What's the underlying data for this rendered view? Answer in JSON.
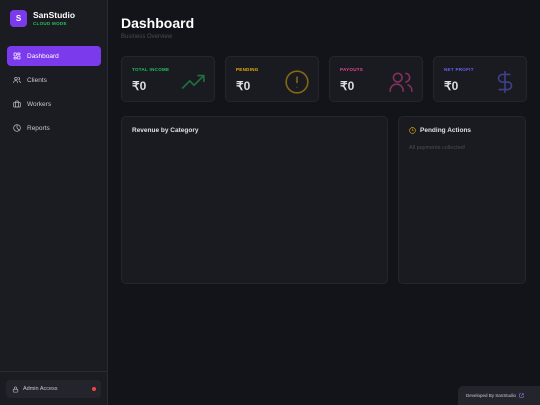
{
  "brand": {
    "logo_letter": "S",
    "name": "SanStudio",
    "subtitle": "CLOUD MODE"
  },
  "nav": [
    {
      "label": "Dashboard",
      "icon": "dashboard-grid-icon",
      "active": true
    },
    {
      "label": "Clients",
      "icon": "users-icon",
      "active": false
    },
    {
      "label": "Workers",
      "icon": "briefcase-icon",
      "active": false
    },
    {
      "label": "Reports",
      "icon": "pie-chart-icon",
      "active": false
    }
  ],
  "admin": {
    "label": "Admin Access",
    "icon": "lock-icon",
    "status_color": "#ef4444"
  },
  "header": {
    "title": "Dashboard",
    "subtitle": "Business Overview"
  },
  "stats": [
    {
      "label": "TOTAL INCOME",
      "value": "₹0",
      "color": "#22c55e",
      "icon": "trending-up-icon"
    },
    {
      "label": "PENDING",
      "value": "₹0",
      "color": "#eab308",
      "icon": "alert-circle-icon"
    },
    {
      "label": "PAYOUTS",
      "value": "₹0",
      "color": "#ec4899",
      "icon": "users-icon"
    },
    {
      "label": "NET PROFIT",
      "value": "₹0",
      "color": "#6366f1",
      "icon": "dollar-icon"
    }
  ],
  "revenue_panel": {
    "title": "Revenue by Category"
  },
  "pending_panel": {
    "title": "Pending Actions",
    "icon": "clock-icon",
    "empty_text": "All payments collected!"
  },
  "footer": {
    "text": "Developed By SanStudio",
    "icon": "external-link-icon"
  },
  "colors": {
    "accent": "#7c3aed",
    "background": "#13131a",
    "sidebar": "#1b1b22"
  }
}
